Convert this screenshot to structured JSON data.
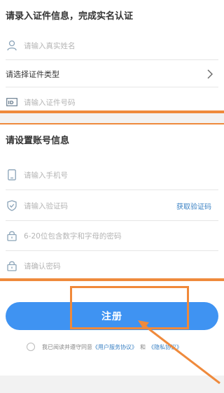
{
  "id_section": {
    "title": "请录入证件信息，完成实名认证",
    "name_placeholder": "请输入真实姓名",
    "id_type_label": "请选择证件类型",
    "id_number_placeholder": "请输入证件号码"
  },
  "account_section": {
    "title": "请设置账号信息",
    "phone_placeholder": "请输入手机号",
    "code_placeholder": "请输入验证码",
    "get_code_label": "获取验证码",
    "password_placeholder": "6-20位包含数字和字母的密码",
    "confirm_password_placeholder": "请确认密码"
  },
  "register_button": "注册",
  "agreement": {
    "prefix": "我已阅读并遵守同意",
    "user_agreement": "《用户服务协议》",
    "and": "和",
    "privacy_agreement": "《隐私协议》"
  },
  "colors": {
    "primary": "#3f93f2",
    "highlight": "#ef8a3c"
  },
  "icons": {
    "name": "person-icon",
    "id_type": "chevron-right-icon",
    "id_number": "id-card-icon",
    "phone": "phone-icon",
    "code": "shield-icon",
    "password": "lock-icon",
    "confirm_password": "lock-icon"
  }
}
